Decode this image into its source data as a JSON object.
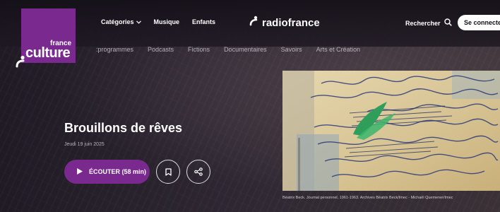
{
  "logo": {
    "small": "france",
    "big": "culture"
  },
  "nav": {
    "categories": "Catégories",
    "music": "Musique",
    "kids": "Enfants",
    "brand": "radiofrance",
    "search": "Rechercher",
    "connect": "Se connecter"
  },
  "subnav": [
    "Les programmes",
    "Podcasts",
    "Fictions",
    "Documentaires",
    "Savoirs",
    "Arts et Création"
  ],
  "subnav_visible": [
    ":programmes",
    "Podcasts",
    "Fictions",
    "Documentaires",
    "Savoirs",
    "Arts et Création"
  ],
  "hero": {
    "title": "Brouillons de rêves",
    "date": "Jeudi 19 juin 2025",
    "play_label": "ÉCOUTER",
    "duration": "(58 min)",
    "caption": "Béatrix Beck. Journal personnel, 1961-1963. Archives Béatrix Beck/Imec - Michaël Quemener/Imec"
  },
  "colors": {
    "brand_purple": "#7a2a8e",
    "connect_bg": "#ffffff"
  },
  "icons": [
    "chevron-down-icon",
    "search-icon",
    "play-icon",
    "bookmark-icon",
    "share-icon",
    "radiofrance-logo-icon"
  ]
}
